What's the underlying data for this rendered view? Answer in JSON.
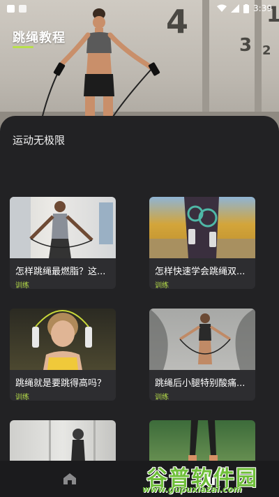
{
  "status_bar": {
    "time": "3:39"
  },
  "hero": {
    "title": "跳绳教程",
    "wall_numbers": [
      "4",
      "3",
      "2",
      "1"
    ]
  },
  "section": {
    "title": "运动无极限"
  },
  "cards": [
    {
      "title": "怎样跳绳最燃脂？这...",
      "tag": "训练"
    },
    {
      "title": "怎样快速学会跳绳双...",
      "tag": "训练"
    },
    {
      "title": "跳绳就是要跳得高吗？",
      "tag": "训练"
    },
    {
      "title": "跳绳后小腿特别酸痛...",
      "tag": "训练"
    },
    {
      "title": "",
      "tag": ""
    },
    {
      "title": "",
      "tag": ""
    }
  ],
  "tabbar": {
    "items": [
      {
        "icon": "home-icon"
      },
      {
        "icon": "bar-chart-icon"
      }
    ]
  },
  "watermark": {
    "name": "谷普软件园",
    "url": "www.gupuxiazai.com"
  },
  "colors": {
    "accent": "#b8e04a",
    "background": "#222224",
    "card": "#2d2d30"
  }
}
